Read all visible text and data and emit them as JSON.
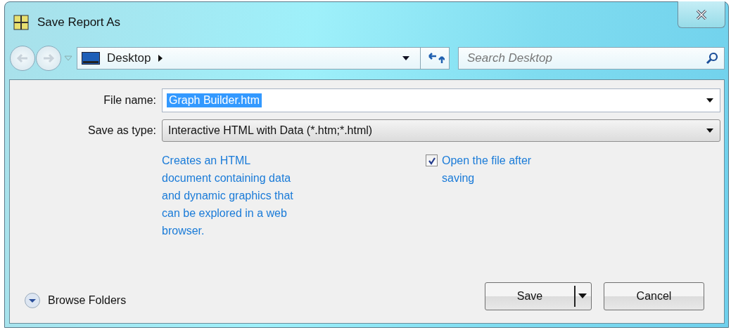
{
  "window": {
    "title": "Save Report As"
  },
  "address_bar": {
    "location": "Desktop"
  },
  "search": {
    "placeholder": "Search Desktop"
  },
  "file_name": {
    "label": "File name:",
    "value": "Graph Builder.htm",
    "selected": true
  },
  "save_as_type": {
    "label": "Save as type:",
    "value": "Interactive HTML with Data (*.htm;*.html)"
  },
  "description": "Creates an HTML document containing data and dynamic graphics that can be explored in a web browser.",
  "open_after_saving": {
    "label": "Open the file after saving",
    "checked": true
  },
  "browse_folders": {
    "label": "Browse Folders"
  },
  "buttons": [
    {
      "label": "Save",
      "kind": "split"
    },
    {
      "label": "Cancel",
      "kind": "plain"
    }
  ]
}
